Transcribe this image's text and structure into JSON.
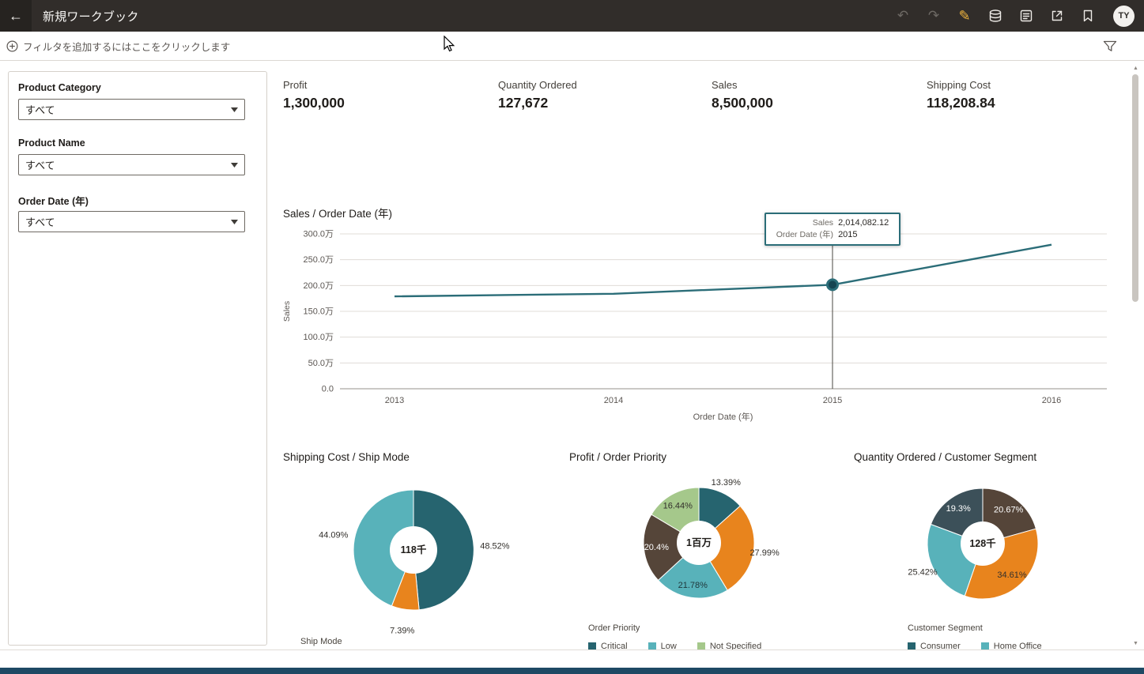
{
  "header": {
    "title": "新規ワークブック",
    "avatar_initials": "TY"
  },
  "filter_bar": {
    "add_filter_label": "フィルタを追加するにはここをクリックします"
  },
  "filter_panel": {
    "filters": [
      {
        "label": "Product Category",
        "value": "すべて"
      },
      {
        "label": "Product Name",
        "value": "すべて"
      },
      {
        "label": "Order Date (年)",
        "value": "すべて"
      }
    ]
  },
  "kpis": [
    {
      "label": "Profit",
      "value": "1,300,000"
    },
    {
      "label": "Quantity Ordered",
      "value": "127,672"
    },
    {
      "label": "Sales",
      "value": "8,500,000"
    },
    {
      "label": "Shipping Cost",
      "value": "118,208.84"
    }
  ],
  "colors": {
    "accent_teal": "#2b6d78",
    "dark_teal": "#26646f",
    "teal": "#58b2ba",
    "orange": "#e8841d",
    "brown": "#554539",
    "green": "#a5c88b",
    "slate": "#3c5059",
    "edit_icon_yellow": "#f2b63f",
    "footer_bar": "#1e4964"
  },
  "chart_data": [
    {
      "type": "line",
      "title": "Sales / Order Date (年)",
      "xlabel": "Order Date (年)",
      "ylabel": "Sales",
      "x": [
        "2013",
        "2014",
        "2015",
        "2016"
      ],
      "values": [
        1790000,
        1840000,
        2014082.12,
        2790000
      ],
      "ylim": [
        0,
        3000000
      ],
      "ytick_labels": [
        "300.0万",
        "250.0万",
        "200.0万",
        "150.0万",
        "100.0万",
        "50.0万",
        "0.0"
      ],
      "grid": "horizontal",
      "legend_position": "none",
      "line_color": "#2b6d78",
      "tooltip": {
        "index": 2,
        "rows": [
          {
            "label": "Sales",
            "value": "2,014,082.12"
          },
          {
            "label": "Order Date (年)",
            "value": "2015"
          }
        ]
      }
    },
    {
      "type": "pie",
      "title": "Shipping Cost / Ship Mode",
      "center_label": "118千",
      "legend_title": "Ship Mode",
      "legend_items": [],
      "segments": [
        {
          "pct": 48.52,
          "label": "48.52%",
          "color": "#26646f",
          "label_pos": "outside"
        },
        {
          "pct": 7.39,
          "label": "7.39%",
          "color": "#e8841d",
          "label_pos": "outside"
        },
        {
          "pct": 44.09,
          "label": "44.09%",
          "color": "#58b2ba",
          "label_pos": "outside"
        }
      ]
    },
    {
      "type": "pie",
      "title": "Profit / Order Priority",
      "center_label": "1百万",
      "legend_title": "Order Priority",
      "legend_items": [
        {
          "label": "Critical",
          "color": "#26646f"
        },
        {
          "label": "Low",
          "color": "#58b2ba"
        },
        {
          "label": "Not Specified",
          "color": "#a5c88b"
        }
      ],
      "segments": [
        {
          "pct": 13.39,
          "label": "13.39%",
          "color": "#26646f",
          "label_pos": "outside"
        },
        {
          "pct": 27.99,
          "label": "27.99%",
          "color": "#e8841d",
          "label_pos": "outside"
        },
        {
          "pct": 21.78,
          "label": "21.78%",
          "color": "#58b2ba",
          "label_pos": "inside",
          "label_color": "#20393d"
        },
        {
          "pct": 20.4,
          "label": "20.4%",
          "color": "#554539",
          "label_pos": "inside",
          "label_color": "#ffffff"
        },
        {
          "pct": 16.44,
          "label": "16.44%",
          "color": "#a5c88b",
          "label_pos": "inside",
          "label_color": "#33302c"
        }
      ]
    },
    {
      "type": "pie",
      "title": "Quantity Ordered / Customer Segment",
      "center_label": "128千",
      "legend_title": "Customer Segment",
      "legend_items": [
        {
          "label": "Consumer",
          "color": "#26646f"
        },
        {
          "label": "Home Office",
          "color": "#58b2ba"
        }
      ],
      "segments": [
        {
          "pct": 20.67,
          "label": "20.67%",
          "color": "#554539",
          "label_pos": "inside",
          "label_color": "#ffffff"
        },
        {
          "pct": 34.61,
          "label": "34.61%",
          "color": "#e8841d",
          "label_pos": "inside",
          "label_color": "#33302c"
        },
        {
          "pct": 25.42,
          "label": "25.42%",
          "color": "#58b2ba",
          "label_pos": "outside"
        },
        {
          "pct": 19.3,
          "label": "19.3%",
          "color": "#3c5059",
          "label_pos": "inside",
          "label_color": "#ffffff"
        }
      ]
    }
  ]
}
